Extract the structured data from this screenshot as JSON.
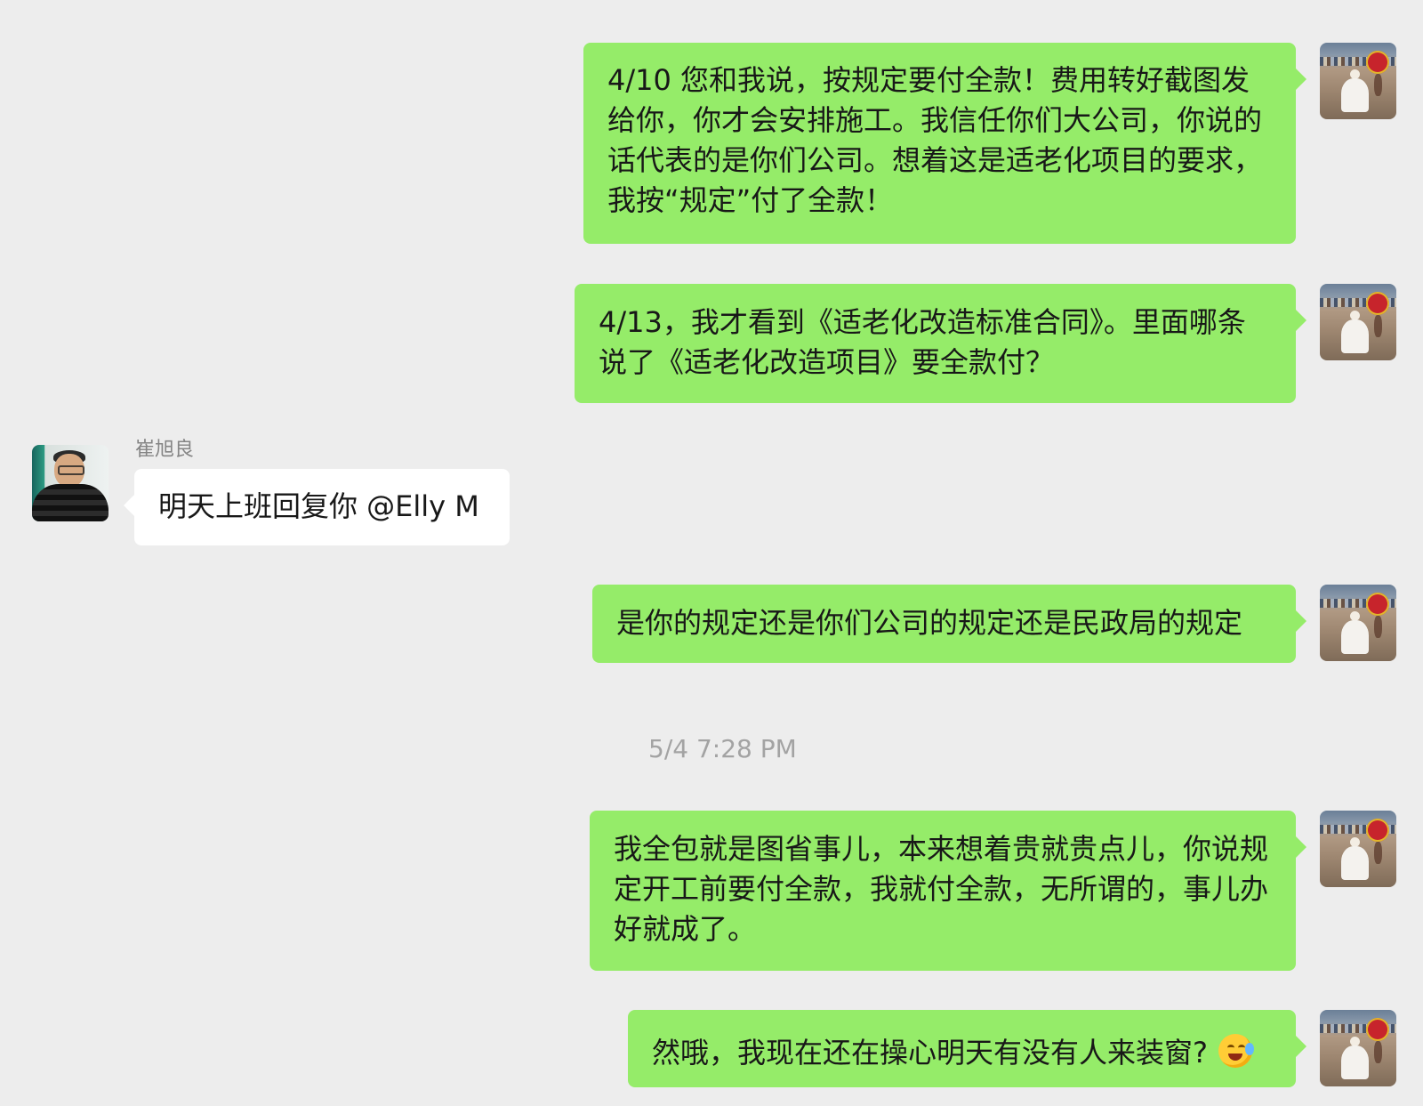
{
  "chat": {
    "messages": [
      {
        "sender": "self",
        "text": "4/10 您和我说，按规定要付全款！费用转好截图发给你，你才会安排施工。我信任你们大公司，你说的话代表的是你们公司。想着这是适老化项目的要求，我按“规定”付了全款！"
      },
      {
        "sender": "self",
        "text": "4/13，我才看到《适老化改造标准合同》。里面哪条说了《适老化改造项目》要全款付？"
      },
      {
        "sender": "other",
        "name": "崔旭良",
        "text": "明天上班回复你 @Elly M"
      },
      {
        "sender": "self",
        "text": "是你的规定还是你们公司的规定还是民政局的规定"
      },
      {
        "sender": "system",
        "text": "5/4 7:28 PM"
      },
      {
        "sender": "self",
        "text": "我全包就是图省事儿，本来想着贵就贵点儿，你说规定开工前要付全款，我就付全款，无所谓的，事儿办好就成了。"
      },
      {
        "sender": "self",
        "text": "然哦，我现在还在操心明天有没有人来装窗?",
        "emoji": "laughing-crying-emoji"
      }
    ]
  },
  "colors": {
    "background": "#ededed",
    "self_bubble": "#95ec69",
    "other_bubble": "#ffffff",
    "timestamp": "#a3a3a3",
    "name": "#858585"
  }
}
